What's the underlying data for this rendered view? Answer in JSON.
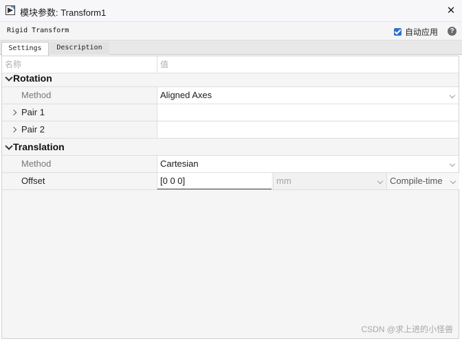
{
  "window": {
    "title": "模块参数: Transform1",
    "close_symbol": "✕"
  },
  "header": {
    "block_name": "Rigid Transform",
    "auto_apply_label": "自动应用",
    "auto_apply_checked": true,
    "help_symbol": "?"
  },
  "tabs": [
    {
      "label": "Settings",
      "active": true
    },
    {
      "label": "Description",
      "active": false
    }
  ],
  "grid": {
    "columns": {
      "name": "名称",
      "value": "值"
    },
    "rotation": {
      "label": "Rotation",
      "method": {
        "label": "Method",
        "value": "Aligned Axes"
      },
      "pair1": {
        "label": "Pair 1"
      },
      "pair2": {
        "label": "Pair 2"
      }
    },
    "translation": {
      "label": "Translation",
      "method": {
        "label": "Method",
        "value": "Cartesian"
      },
      "offset": {
        "label": "Offset",
        "value": "[0 0 0]",
        "unit": "mm",
        "config": "Compile-time"
      }
    }
  },
  "watermark": "CSDN @求上进的小怪兽",
  "colors": {
    "accent": "#2f6fcf"
  }
}
